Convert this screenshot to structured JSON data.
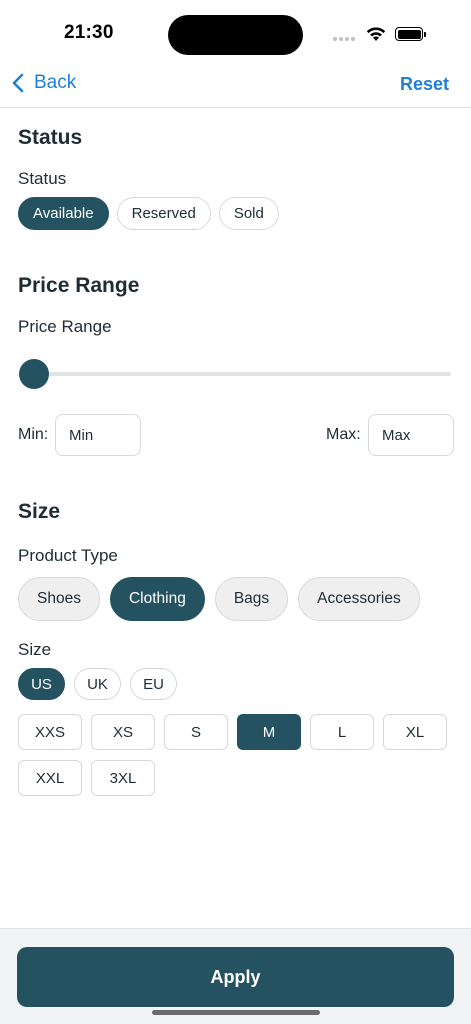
{
  "status_bar": {
    "time": "21:30"
  },
  "nav": {
    "back_label": "Back",
    "reset_label": "Reset"
  },
  "status_section": {
    "title": "Status",
    "label": "Status",
    "options": [
      "Available",
      "Reserved",
      "Sold"
    ],
    "selected": "Available"
  },
  "price_section": {
    "title": "Price Range",
    "label": "Price Range",
    "slider_value_fraction": 0.0,
    "min_label": "Min:",
    "min_placeholder": "Min",
    "max_label": "Max:",
    "max_placeholder": "Max"
  },
  "size_section": {
    "title": "Size",
    "product_type_label": "Product Type",
    "product_types": [
      "Shoes",
      "Clothing",
      "Bags",
      "Accessories"
    ],
    "selected_product_type": "Clothing",
    "size_label": "Size",
    "systems": [
      "US",
      "UK",
      "EU"
    ],
    "selected_system": "US",
    "sizes": [
      "XXS",
      "XS",
      "S",
      "M",
      "L",
      "XL",
      "XXL",
      "3XL"
    ],
    "selected_size": "M"
  },
  "footer": {
    "apply_label": "Apply"
  },
  "colors": {
    "accent": "#255261",
    "link": "#1f7fd6"
  }
}
